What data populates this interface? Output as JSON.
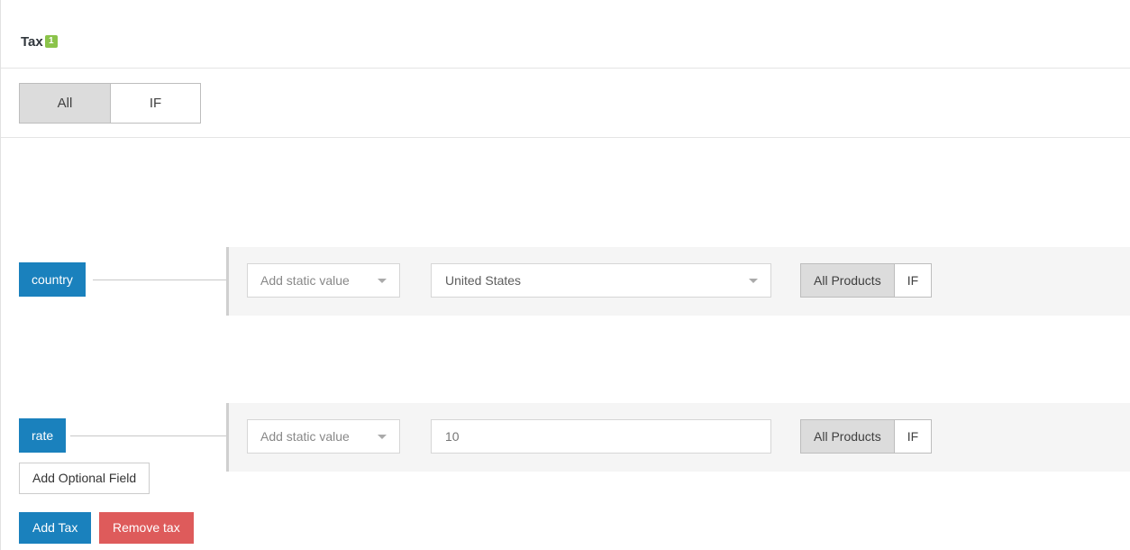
{
  "header": {
    "title": "Tax",
    "badge": "1"
  },
  "mode_tabs": {
    "items": [
      {
        "label": "All",
        "active": true
      },
      {
        "label": "IF",
        "active": false
      }
    ]
  },
  "fields": [
    {
      "name": "country",
      "value_source": "Add static value",
      "value": "United States",
      "value_kind": "select",
      "scope": [
        {
          "label": "All Products",
          "active": true
        },
        {
          "label": "IF",
          "active": false
        }
      ]
    },
    {
      "name": "rate",
      "value_source": "Add static value",
      "value": "10",
      "value_kind": "text",
      "scope": [
        {
          "label": "All Products",
          "active": true
        },
        {
          "label": "IF",
          "active": false
        }
      ]
    }
  ],
  "actions": {
    "add_optional_field": "Add Optional Field",
    "add_tax": "Add Tax",
    "remove_tax": "Remove tax"
  },
  "colors": {
    "chip_blue": "#1a81bd",
    "badge_green": "#8bc34a",
    "danger_red": "#de5b5b",
    "panel_gray": "#f5f5f5",
    "active_tab_gray": "#dcdcdc"
  }
}
